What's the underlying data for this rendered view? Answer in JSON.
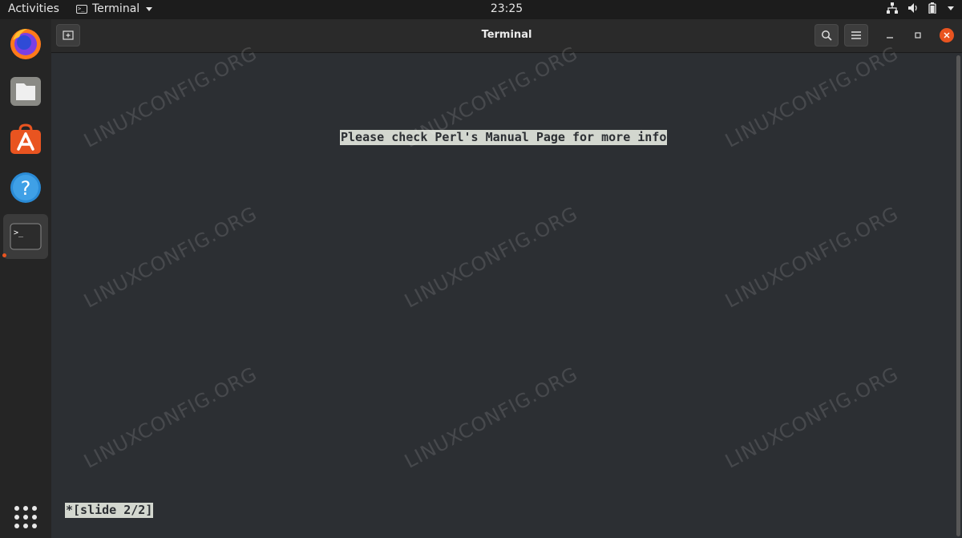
{
  "topbar": {
    "activities_label": "Activities",
    "app_menu_label": "Terminal",
    "clock": "23:25",
    "tray_icons": [
      "network-icon",
      "volume-icon",
      "battery-icon",
      "system-menu-chevron-icon"
    ]
  },
  "dock": {
    "items": [
      {
        "name": "firefox-icon"
      },
      {
        "name": "files-icon"
      },
      {
        "name": "ubuntu-software-icon"
      },
      {
        "name": "help-icon"
      },
      {
        "name": "terminal-icon",
        "active": true
      }
    ],
    "show_apps_icon": "app-grid-icon",
    "accent_color": "#e95420"
  },
  "window": {
    "title": "Terminal",
    "header_buttons": [
      "new-tab-icon",
      "search-icon",
      "hamburger-menu-icon",
      "minimize-icon",
      "maximize-icon",
      "close-icon"
    ]
  },
  "terminal": {
    "message": "Please check Perl's Manual Page for more info",
    "status": "*[slide 2/2]"
  },
  "watermark": {
    "text": "LINUXCONFIG.ORG"
  }
}
